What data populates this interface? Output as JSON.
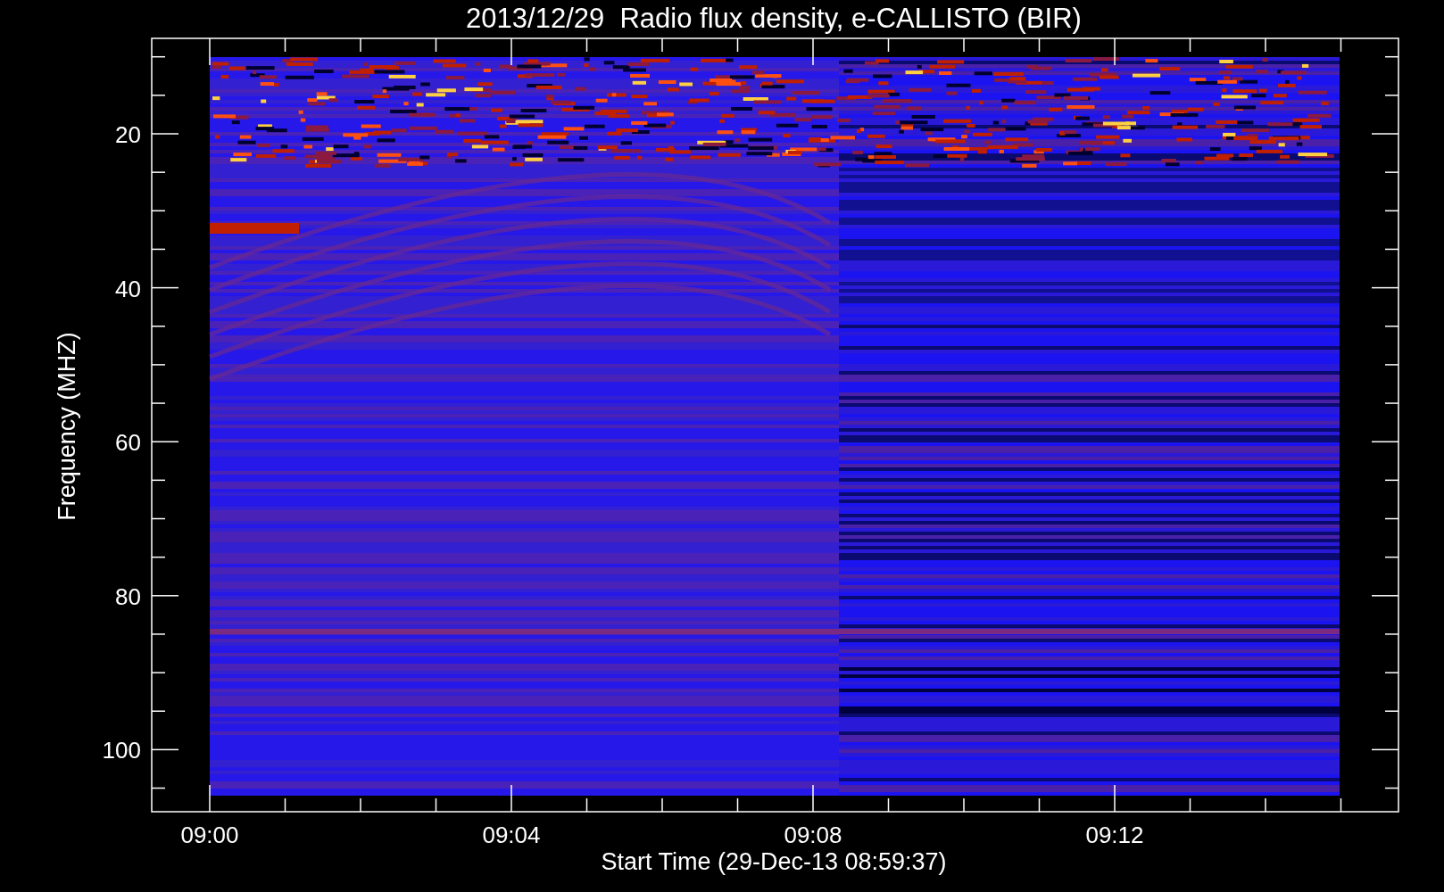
{
  "title": "2013/12/29  Radio flux density, e-CALLISTO (BIR)",
  "y_axis": {
    "label": "Frequency (MHZ)",
    "ticks": [
      "20",
      "40",
      "60",
      "80",
      "100"
    ]
  },
  "x_axis": {
    "label": "Start Time (29-Dec-13 08:59:37)",
    "ticks": [
      "09:00",
      "09:04",
      "09:08",
      "09:12"
    ]
  }
}
